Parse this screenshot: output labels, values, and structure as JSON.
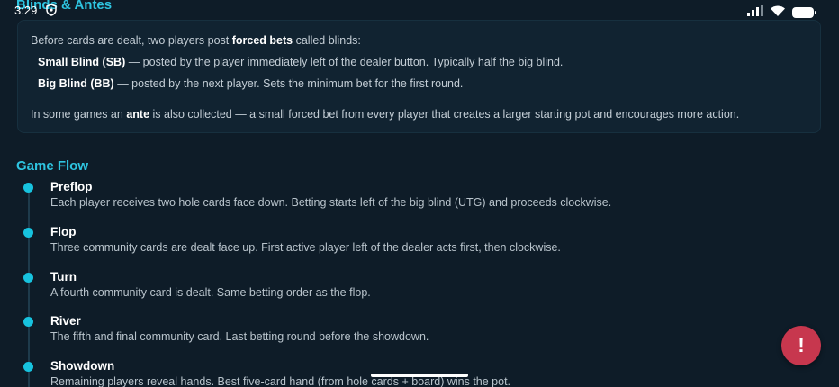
{
  "status_bar": {
    "time": "3:29"
  },
  "blinds_section": {
    "heading": "Blinds & Antes",
    "intro_prefix": "Before cards are dealt, two players post ",
    "intro_bold": "forced bets",
    "intro_suffix": " called blinds:",
    "small_blind_label": "Small Blind (SB)",
    "small_blind_text": " — posted by the player immediately left of the dealer button. Typically half the big blind.",
    "big_blind_label": "Big Blind (BB)",
    "big_blind_text": " — posted by the next player. Sets the minimum bet for the first round.",
    "ante_prefix": "In some games an ",
    "ante_bold": "ante",
    "ante_suffix": " is also collected — a small forced bet from every player that creates a larger starting pot and encourages more action."
  },
  "game_flow": {
    "heading": "Game Flow",
    "steps": [
      {
        "title": "Preflop",
        "desc": "Each player receives two hole cards face down. Betting starts left of the big blind (UTG) and proceeds clockwise."
      },
      {
        "title": "Flop",
        "desc": "Three community cards are dealt face up. First active player left of the dealer acts first, then clockwise."
      },
      {
        "title": "Turn",
        "desc": "A fourth community card is dealt. Same betting order as the flop."
      },
      {
        "title": "River",
        "desc": "The fifth and final community card. Last betting round before the showdown."
      },
      {
        "title": "Showdown",
        "desc": "Remaining players reveal hands. Best five-card hand (from hole cards + board) wins the pot."
      }
    ]
  },
  "fab": {
    "icon": "exclamation-icon",
    "symbol": "!"
  },
  "colors": {
    "background": "#0e1c28",
    "accent": "#2ec4e0",
    "fab": "#c7374e"
  }
}
